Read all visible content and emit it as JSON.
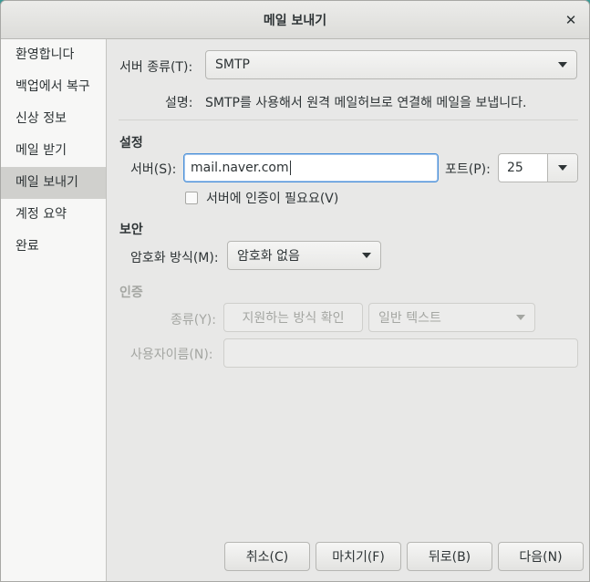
{
  "window": {
    "title": "메일 보내기",
    "close_glyph": "✕"
  },
  "sidebar": {
    "items": [
      {
        "label": "환영합니다"
      },
      {
        "label": "백업에서 복구"
      },
      {
        "label": "신상 정보"
      },
      {
        "label": "메일 받기"
      },
      {
        "label": "메일 보내기",
        "active": true
      },
      {
        "label": "계정 요약"
      },
      {
        "label": "완료"
      }
    ]
  },
  "server_type": {
    "label": "서버 종류(T):",
    "value": "SMTP",
    "desc_label": "설명:",
    "description": "SMTP를 사용해서 원격 메일허브로 연결해 메일을 보냅니다."
  },
  "settings": {
    "heading": "설정",
    "server_label": "서버(S):",
    "server_value": "mail.naver.com",
    "port_label": "포트(P):",
    "port_value": "25",
    "auth_required_label": "서버에 인증이 필요요(V)",
    "auth_required_checked": false
  },
  "security": {
    "heading": "보안",
    "encryption_label": "암호화 방식(M):",
    "encryption_value": "암호화 없음"
  },
  "auth": {
    "heading": "인증",
    "type_label": "종류(Y):",
    "check_types_button": "지원하는 방식 확인",
    "type_value": "일반 텍스트",
    "username_label": "사용자이름(N):",
    "username_value": ""
  },
  "footer": {
    "cancel": "취소(C)",
    "finish": "마치기(F)",
    "back": "뒤로(B)",
    "next": "다음(N)"
  }
}
